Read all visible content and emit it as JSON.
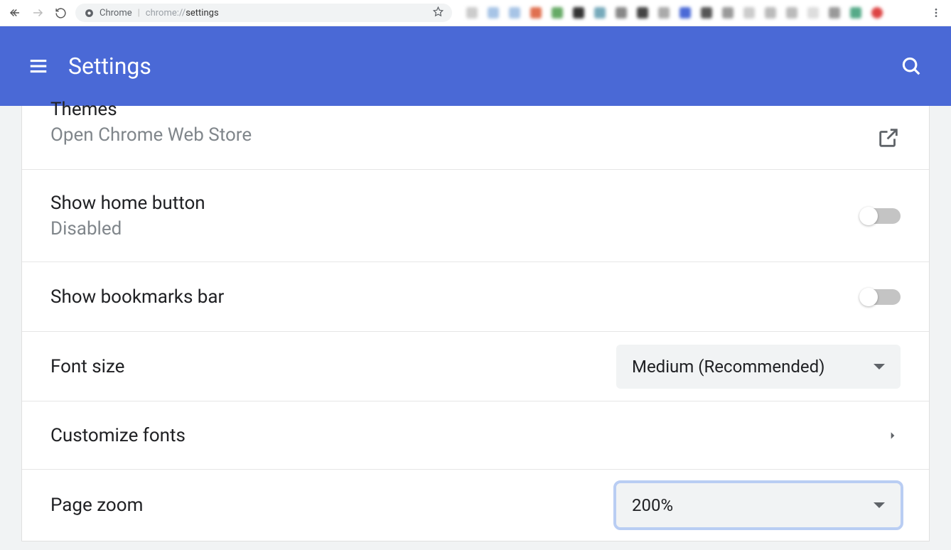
{
  "browser": {
    "url_label": "Chrome",
    "url_scheme": "chrome://",
    "url_path": "settings"
  },
  "header": {
    "title": "Settings"
  },
  "settings": {
    "themes": {
      "title": "Themes",
      "subtitle": "Open Chrome Web Store"
    },
    "home_button": {
      "title": "Show home button",
      "subtitle": "Disabled"
    },
    "bookmarks_bar": {
      "title": "Show bookmarks bar"
    },
    "font_size": {
      "title": "Font size",
      "value": "Medium (Recommended)"
    },
    "customize_fonts": {
      "title": "Customize fonts"
    },
    "page_zoom": {
      "title": "Page zoom",
      "value": "200%"
    }
  }
}
